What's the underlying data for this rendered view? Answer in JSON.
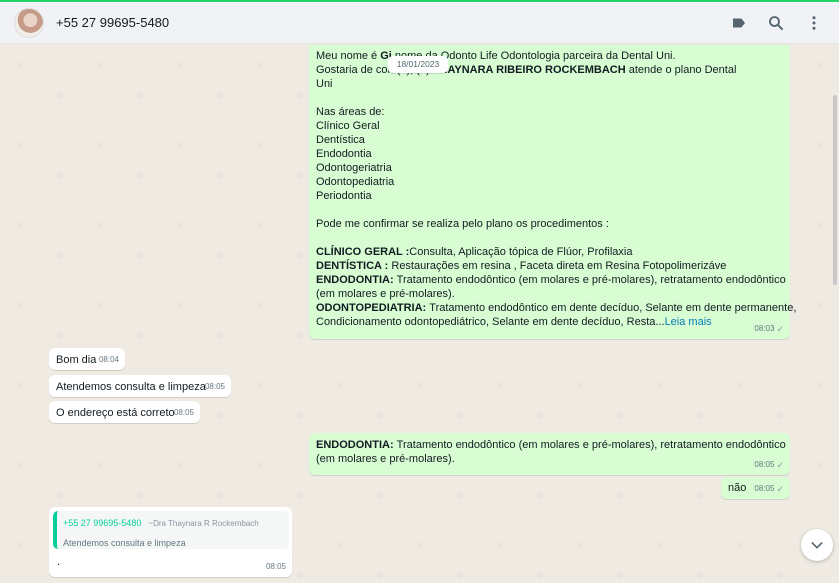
{
  "header": {
    "contact": "+55 27 99695-5480",
    "icons": [
      "label-icon",
      "search-icon",
      "menu-icon"
    ]
  },
  "chat": {
    "date_pill": "18/01/2023",
    "messages": [
      {
        "id": "m1",
        "direction": "out",
        "lines": [
          [
            {
              "t": "Meu nome é "
            },
            {
              "t": "Gi",
              "b": true
            },
            {
              "t": "            nome da Odonto Life Odontologia parceira da Dental Uni."
            }
          ],
          [
            {
              "t": "Gostaria de con                    (o), (a) "
            },
            {
              "t": "THAYNARA RIBEIRO ROCKEMBACH",
              "b": true
            },
            {
              "t": " atende o plano Dental"
            }
          ],
          [
            {
              "t": "Uni"
            }
          ],
          [
            {
              "t": ""
            }
          ],
          [
            {
              "t": "Nas áreas de:"
            }
          ],
          [
            {
              "t": "Clínico Geral"
            }
          ],
          [
            {
              "t": "Dentística"
            }
          ],
          [
            {
              "t": "Endodontia"
            }
          ],
          [
            {
              "t": "Odontogeriatria"
            }
          ],
          [
            {
              "t": "Odontopediatria"
            }
          ],
          [
            {
              "t": "Periodontia"
            }
          ],
          [
            {
              "t": ""
            }
          ],
          [
            {
              "t": "Pode me confirmar se realiza pelo plano  os procedimentos :"
            }
          ],
          [
            {
              "t": ""
            }
          ],
          [
            {
              "t": "CLÍNICO GERAL :",
              "b": true
            },
            {
              "t": "Consulta, Aplicação tópica de Flúor, Profilaxia"
            }
          ],
          [
            {
              "t": "DENTÍSTICA : ",
              "b": true
            },
            {
              "t": "Restaurações em resina , Faceta direta em Resina Fotopolimerizáve"
            }
          ],
          [
            {
              "t": "ENDODONTIA: ",
              "b": true
            },
            {
              "t": "Tratamento endodôntico (em molares e pré-molares), retratamento endodôntico"
            }
          ],
          [
            {
              "t": "(em molares e pré-molares)."
            }
          ],
          [
            {
              "t": "ODONTOPEDIATRIA: ",
              "b": true
            },
            {
              "t": "Tratamento endodôntico em dente decíduo, Selante em dente permanente,"
            }
          ],
          [
            {
              "t": "Condicionamento odontopediátrico, Selante em dente decíduo, Resta..."
            },
            {
              "t": "Leia mais",
              "more": true
            }
          ]
        ],
        "time": "08:03",
        "check": "✓"
      },
      {
        "id": "m2",
        "direction": "in",
        "lines": [
          [
            {
              "t": "Bom dia"
            }
          ]
        ],
        "time": "08:04"
      },
      {
        "id": "m3",
        "direction": "in",
        "lines": [
          [
            {
              "t": "Atendemos consulta e limpeza"
            }
          ]
        ],
        "time": "08:05"
      },
      {
        "id": "m4",
        "direction": "in",
        "lines": [
          [
            {
              "t": "O endereço está correto"
            }
          ]
        ],
        "time": "08:05"
      },
      {
        "id": "m5",
        "direction": "out",
        "lines": [
          [
            {
              "t": "ENDODONTIA: ",
              "b": true
            },
            {
              "t": "Tratamento endodôntico (em molares e pré-molares), retratamento endodôntico"
            }
          ],
          [
            {
              "t": "(em molares e pré-molares)."
            }
          ]
        ],
        "time": "08:05",
        "check": "✓"
      },
      {
        "id": "m6",
        "direction": "out",
        "lines": [
          [
            {
              "t": "não"
            }
          ]
        ],
        "time": "08:05",
        "check": "✓"
      },
      {
        "id": "m7",
        "direction": "in",
        "quote": {
          "name": "+55 27 99695-5480",
          "pushname": "~Dra Thaynara R Rockembach",
          "text": "Atendemos consulta e limpeza"
        },
        "lines": [
          [
            {
              "t": "."
            }
          ]
        ],
        "time": "08:05"
      }
    ]
  }
}
